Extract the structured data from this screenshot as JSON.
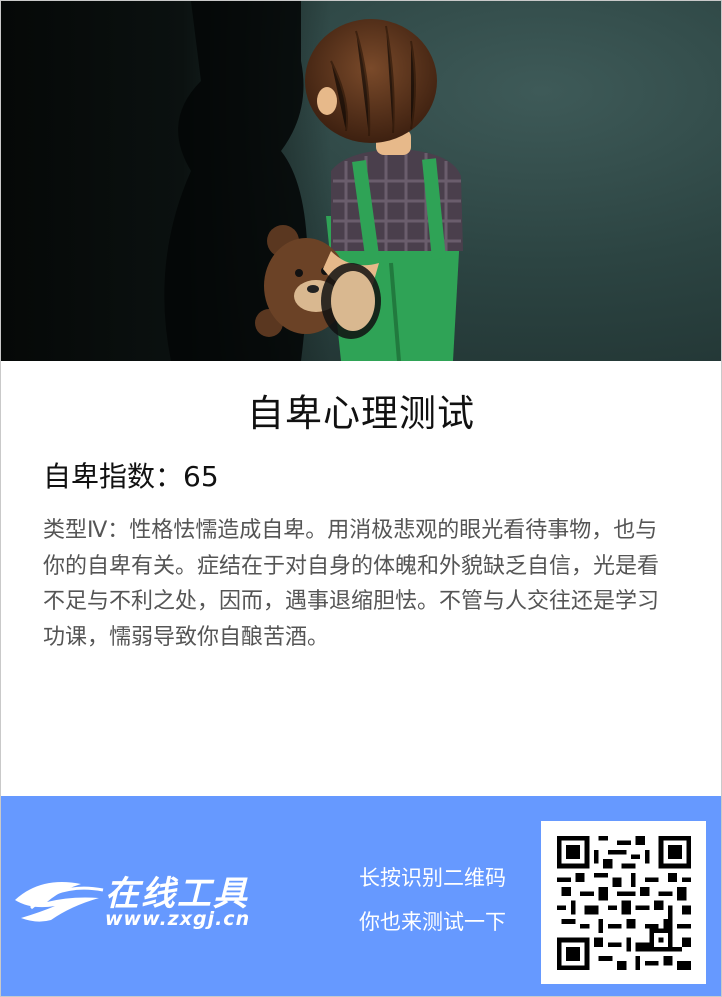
{
  "header": {
    "title": "自卑心理测试"
  },
  "result": {
    "score_label": "自卑指数：65",
    "description": "类型Ⅳ：性格怯懦造成自卑。用消极悲观的眼光看待事物，也与你的自卑有关。症结在于对自身的体魄和外貌缺乏自信，光是看不足与不利之处，因而，遇事退缩胆怯。不管与人交往还是学习功课，懦弱导致你自酿苦酒。"
  },
  "footer": {
    "brand_name": "在线工具",
    "brand_url": "www.zxgj.cn",
    "qr_line1": "长按识别二维码",
    "qr_line2": "你也来测试一下",
    "background_color": "#6699ff"
  },
  "hero": {
    "image": "boy-with-teddy-bear-illustration"
  }
}
